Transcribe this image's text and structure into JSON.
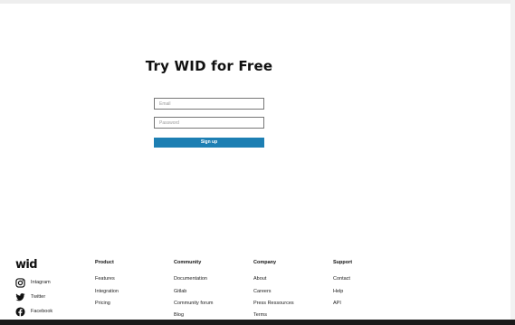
{
  "signup": {
    "title": "Try WID for Free",
    "email_placeholder": "Email",
    "password_placeholder": "Password",
    "button_label": "Sign up"
  },
  "footer": {
    "logo_text": "wid",
    "social": [
      {
        "label": "Intagram",
        "icon": "instagram-icon"
      },
      {
        "label": "Twitter",
        "icon": "twitter-icon"
      },
      {
        "label": "Facebook",
        "icon": "facebook-icon"
      }
    ],
    "columns": [
      {
        "title": "Product",
        "links": [
          "Features",
          "Integration",
          "Pricing"
        ]
      },
      {
        "title": "Community",
        "links": [
          "Documentation",
          "Gitlab",
          "Community forum",
          "Blog"
        ]
      },
      {
        "title": "Company",
        "links": [
          "About",
          "Careers",
          "Press Ressources",
          "Terms"
        ]
      },
      {
        "title": "Support",
        "links": [
          "Contact",
          "Help",
          "API"
        ]
      }
    ]
  },
  "colors": {
    "accent": "#1d7fb3",
    "text": "#111111",
    "background": "#ffffff"
  }
}
